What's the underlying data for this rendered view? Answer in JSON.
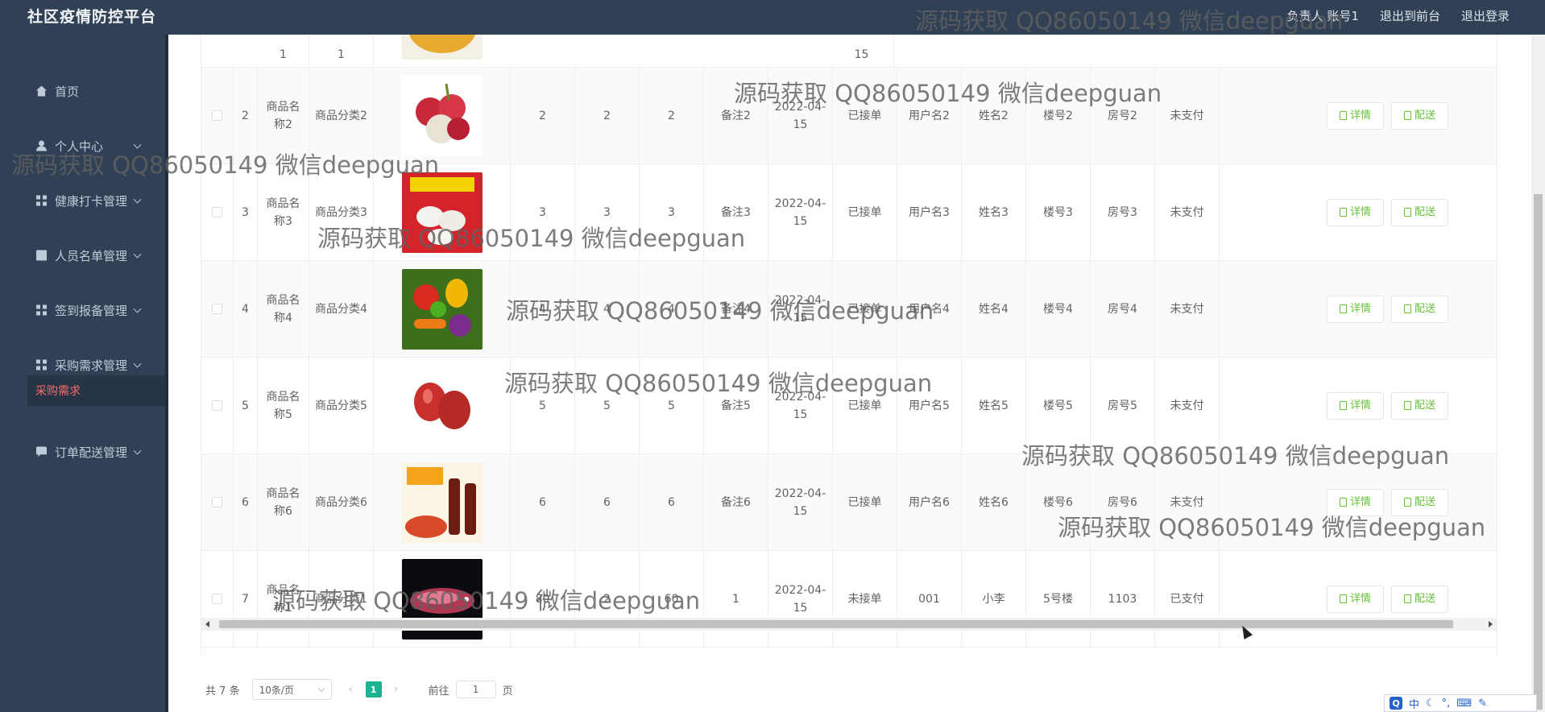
{
  "header": {
    "brand": "社区疫情防控平台",
    "nav": [
      "负责人 账号1",
      "退出到前台",
      "退出登录"
    ]
  },
  "sidebar": {
    "items": [
      {
        "label": "首页",
        "icon": "home-icon",
        "has_children": false
      },
      {
        "label": "个人中心",
        "icon": "user-icon",
        "has_children": true
      },
      {
        "label": "健康打卡管理",
        "icon": "grid-icon",
        "has_children": true
      },
      {
        "label": "人员名单管理",
        "icon": "clipboard-icon",
        "has_children": true
      },
      {
        "label": "签到报备管理",
        "icon": "grid-icon",
        "has_children": true
      },
      {
        "label": "采购需求管理",
        "icon": "grid-icon",
        "has_children": true
      },
      {
        "label": "订单配送管理",
        "icon": "chat-icon",
        "has_children": true
      }
    ],
    "active_submenu": "采购需求"
  },
  "table": {
    "top_row_partial": {
      "c1": "1",
      "c2": "1",
      "date_tail": "15"
    },
    "rows": [
      {
        "index": "2",
        "name": "商品名称2",
        "category": "商品分类2",
        "image": "lychee",
        "q1": "2",
        "q2": "2",
        "q3": "2",
        "note": "备注2",
        "date": "2022-04-15",
        "status": "已接单",
        "username": "用户名2",
        "realname": "姓名2",
        "building": "楼号2",
        "room": "房号2",
        "pay": "未支付"
      },
      {
        "index": "3",
        "name": "商品名称3",
        "category": "商品分类3",
        "image": "dumplings",
        "q1": "3",
        "q2": "3",
        "q3": "3",
        "note": "备注3",
        "date": "2022-04-15",
        "status": "已接单",
        "username": "用户名3",
        "realname": "姓名3",
        "building": "楼号3",
        "room": "房号3",
        "pay": "未支付"
      },
      {
        "index": "4",
        "name": "商品名称4",
        "category": "商品分类4",
        "image": "vegetables",
        "q1": "4",
        "q2": "4",
        "q3": "4",
        "note": "备注4",
        "date": "2022-04-15",
        "status": "已接单",
        "username": "用户名4",
        "realname": "姓名4",
        "building": "楼号4",
        "room": "房号4",
        "pay": "未支付"
      },
      {
        "index": "5",
        "name": "商品名称5",
        "category": "商品分类5",
        "image": "wax-apple",
        "q1": "5",
        "q2": "5",
        "q3": "5",
        "note": "备注5",
        "date": "2022-04-15",
        "status": "已接单",
        "username": "用户名5",
        "realname": "姓名5",
        "building": "楼号5",
        "room": "房号5",
        "pay": "未支付"
      },
      {
        "index": "6",
        "name": "商品名称6",
        "category": "商品分类6",
        "image": "fish-sauce",
        "q1": "6",
        "q2": "6",
        "q3": "6",
        "note": "备注6",
        "date": "2022-04-15",
        "status": "已接单",
        "username": "用户名6",
        "realname": "姓名6",
        "building": "楼号6",
        "room": "房号6",
        "pay": "未支付"
      },
      {
        "index": "7",
        "name": "商品名称1",
        "category": "商品分类1",
        "image": "arowana",
        "q1": "80",
        "q2": "2",
        "q3": "60",
        "note": "1",
        "date": "2022-04-15",
        "status": "未接单",
        "username": "001",
        "realname": "小李",
        "building": "5号楼",
        "room": "1103",
        "pay": "已支付"
      }
    ],
    "actions": {
      "detail": "详情",
      "deliver": "配送"
    }
  },
  "pagination": {
    "total_prefix": "共",
    "total": "7",
    "total_suffix": "条",
    "page_size": "10条/页",
    "current_page": "1",
    "goto_prefix": "前往",
    "goto_value": "1",
    "goto_suffix": "页"
  },
  "watermark": "源码获取 QQ86050149 微信deepguan",
  "ime": {
    "lang": "中",
    "logo": "Q"
  }
}
